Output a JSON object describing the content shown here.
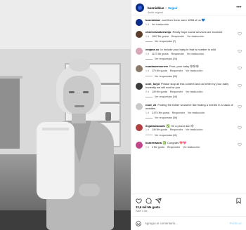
{
  "header": {
    "username": "bonnieblue",
    "separator": "•",
    "follow_label": "Seguir",
    "audio_label": "Audio original",
    "more_icon": "more-horizontal-icon"
  },
  "caption": {
    "username": "bonnieblue",
    "text": "and then there were 1058 of us 💙",
    "time": "1 d",
    "translate_label": "Ver traducción",
    "avatar_color": "#0a2a86"
  },
  "comments": [
    {
      "username": "cheeneseakeesinjo",
      "text": "Really hope social services are involved",
      "time": "1 d",
      "likes": "1967 Me gusta",
      "reply_label": "Responder",
      "translate_label": "Ver traducción",
      "replies_label": "Ver respuestas (7)",
      "avatar_color": "#5a3d2b"
    },
    {
      "username": "emjane.xx",
      "text": "to include your baby in that is number is wild",
      "time": "1 d",
      "likes": "1127 Me gusta",
      "reply_label": "Responder",
      "translate_label": "Ver traducción",
      "replies_label": "Ver respuestas (24)",
      "avatar_color": "#d8a7b9"
    },
    {
      "username": "numbnernnerrrrr",
      "text": "Poor, poor baby 😩😩😩",
      "time": "1 d",
      "likes": "170 Me gusta",
      "reply_label": "Responder",
      "translate_label": "Ver traducción",
      "replies_label": "Ver respuestas (26)",
      "avatar_color": "#8b7a6a"
    },
    {
      "username": "oom_boy3",
      "text": "Please stop all this content and do better by your baby honestly we will root for you",
      "time": "2 d",
      "likes": "149 Me gusta",
      "reply_label": "Responder",
      "translate_label": "Ver traducción",
      "replies_label": "Ver respuestas (16)",
      "avatar_color": "#3b3b3b"
    },
    {
      "username": "noot_22",
      "text": "Finding the father would be like finding a needle in a stack of needles",
      "time": "1 d",
      "likes": "2.074 Me gusta",
      "reply_label": "Responder",
      "translate_label": "Ver traducción",
      "replies_label": "Ver respuestas (36)",
      "avatar_color": "#c9c9c9"
    },
    {
      "username": "itsjulianwoods",
      "text": "✅ I'm a proud dad 😝",
      "time": "1 d",
      "likes": "146 Me gusta",
      "reply_label": "Responder",
      "translate_label": "Ver traducción",
      "replies_label": "Ver respuestas (11)",
      "avatar_color": "#b04040"
    },
    {
      "username": "bcarrmanna",
      "text": "✅ Congrats 💖💖",
      "time": "1 d",
      "likes": "2 Me gusta",
      "reply_label": "Responder",
      "translate_label": "Ver traducción",
      "replies_label": "",
      "avatar_color": "#c0468a"
    }
  ],
  "actions": {
    "like_icon": "heart-icon",
    "comment_icon": "comment-icon",
    "share_icon": "send-icon",
    "save_icon": "bookmark-icon",
    "likes_text": "12,6 mil Me gusta",
    "time_ago": "Hace 1 día"
  },
  "add_comment": {
    "placeholder": "Agrega un comentario...",
    "publish_label": "Publicar",
    "emoji_icon": "smiley-icon"
  }
}
